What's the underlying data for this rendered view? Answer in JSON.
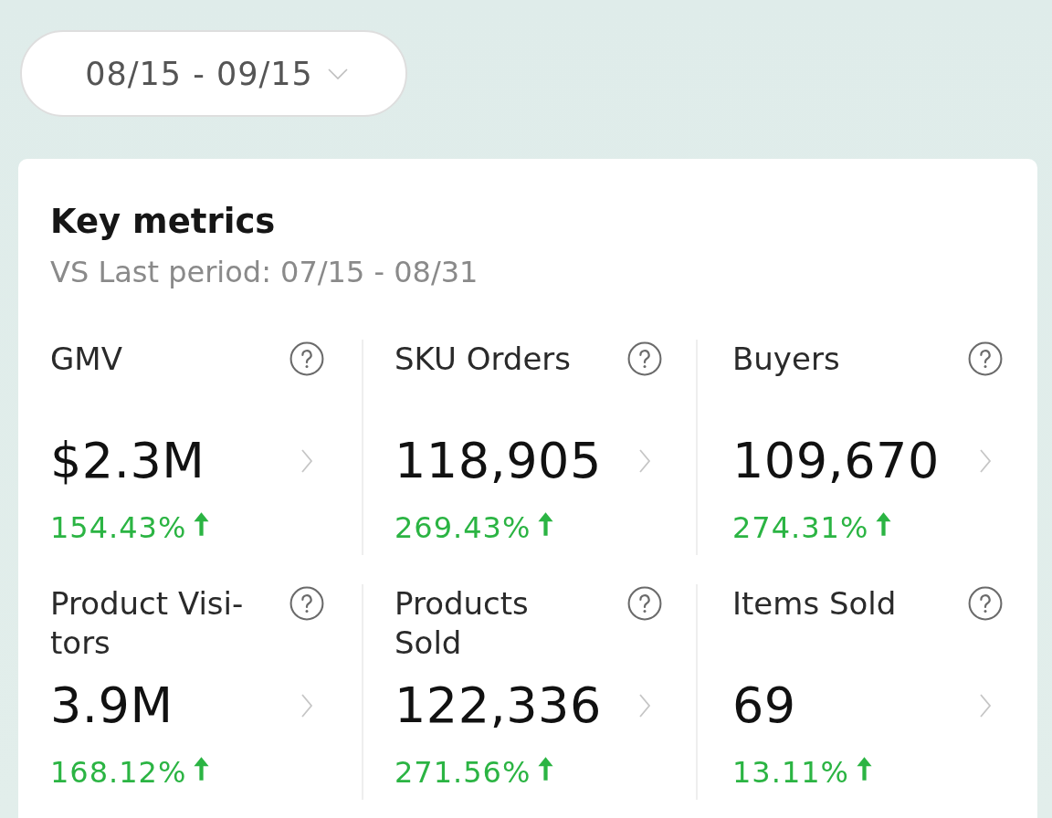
{
  "date_range": {
    "label": "08/15 - 09/15"
  },
  "metrics_card": {
    "title": "Key metrics",
    "comparison": "VS Last period: 07/15 - 08/31",
    "metrics": [
      {
        "label": "GMV",
        "value": "$2.3M",
        "change": "154.43%",
        "rising": true
      },
      {
        "label": "SKU Orders",
        "value": "118,905",
        "change": "269.43%",
        "rising": true
      },
      {
        "label": "Buyers",
        "value": "109,670",
        "change": "274.31%",
        "rising": true
      },
      {
        "label": "Product Visi-tors",
        "value": "3.9M",
        "change": "168.12%",
        "rising": true
      },
      {
        "label": "Products Sold",
        "value": "122,336",
        "change": "271.56%",
        "rising": true
      },
      {
        "label": "Items Sold",
        "value": "69",
        "change": "13.11%",
        "rising": true
      }
    ]
  }
}
